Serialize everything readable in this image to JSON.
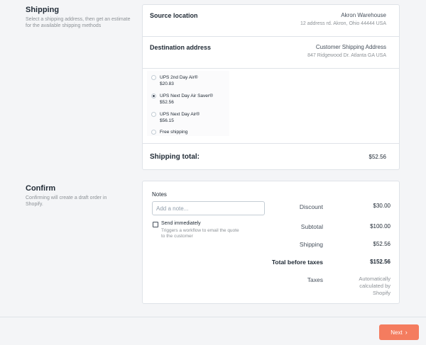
{
  "shipping_section": {
    "title": "Shipping",
    "description": "Select a shipping address, then get an estimate for the available shipping methods"
  },
  "source": {
    "label": "Source location",
    "name": "Akron Warehouse",
    "address": "12 address rd. Akron, Ohio 44444 USA"
  },
  "destination": {
    "label": "Destination address",
    "name": "Customer Shipping Address",
    "address": "847 Ridgewood Dr. Atlanta GA USA"
  },
  "shipping_methods": [
    {
      "name": "UPS 2nd Day Air®",
      "price": "$20.83",
      "selected": false
    },
    {
      "name": "UPS Next Day Air Saver®",
      "price": "$52.56",
      "selected": true
    },
    {
      "name": "UPS Next Day Air®",
      "price": "$56.15",
      "selected": false
    },
    {
      "name": "Free shipping",
      "price": "",
      "selected": false
    }
  ],
  "shipping_total": {
    "label": "Shipping total:",
    "value": "$52.56"
  },
  "confirm_section": {
    "title": "Confirm",
    "description": "Confirming will create a draft order in Shopify."
  },
  "notes": {
    "label": "Notes",
    "placeholder": "Add a note...",
    "value": ""
  },
  "send_immediately": {
    "label": "Send immediately",
    "help": "Triggers a workflow to email the quote to the customer",
    "checked": false
  },
  "summary": {
    "discount": {
      "label": "Discount",
      "value": "$30.00"
    },
    "subtotal": {
      "label": "Subtotal",
      "value": "$100.00"
    },
    "shipping": {
      "label": "Shipping",
      "value": "$52.56"
    },
    "total_before_taxes": {
      "label": "Total before taxes",
      "value": "$152.56"
    },
    "taxes": {
      "label": "Taxes",
      "value": "Automatically calculated by Shopify"
    }
  },
  "footer": {
    "next_label": "Next"
  },
  "colors": {
    "accent": "#f47c5f",
    "border": "#dfe3e8",
    "background": "#f4f5f7"
  },
  "icons": {
    "next": "chevron-right-icon"
  }
}
